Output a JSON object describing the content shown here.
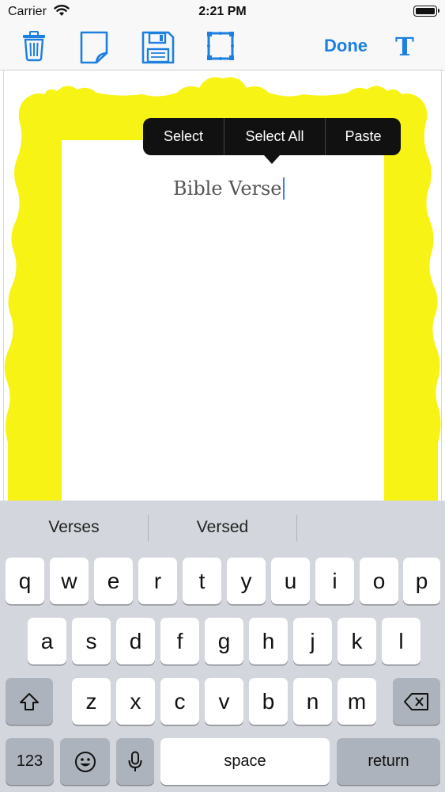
{
  "status": {
    "carrier": "Carrier",
    "time": "2:21 PM"
  },
  "toolbar": {
    "tools": [
      {
        "icon": "trash-icon"
      },
      {
        "icon": "new-page-icon"
      },
      {
        "icon": "save-icon"
      },
      {
        "icon": "frame-icon"
      }
    ],
    "done_label": "Done",
    "text_tool_label": "T"
  },
  "canvas": {
    "frame_color": "#f7f314",
    "verse_text": "Bible Verse"
  },
  "edit_menu": {
    "items": [
      "Select",
      "Select All",
      "Paste"
    ]
  },
  "keyboard": {
    "suggestions": [
      "Verses",
      "Versed",
      ""
    ],
    "row1": [
      "q",
      "w",
      "e",
      "r",
      "t",
      "y",
      "u",
      "i",
      "o",
      "p"
    ],
    "row2": [
      "a",
      "s",
      "d",
      "f",
      "g",
      "h",
      "j",
      "k",
      "l"
    ],
    "row3": [
      "z",
      "x",
      "c",
      "v",
      "b",
      "n",
      "m"
    ],
    "numbers_label": "123",
    "space_label": "space",
    "return_label": "return"
  }
}
